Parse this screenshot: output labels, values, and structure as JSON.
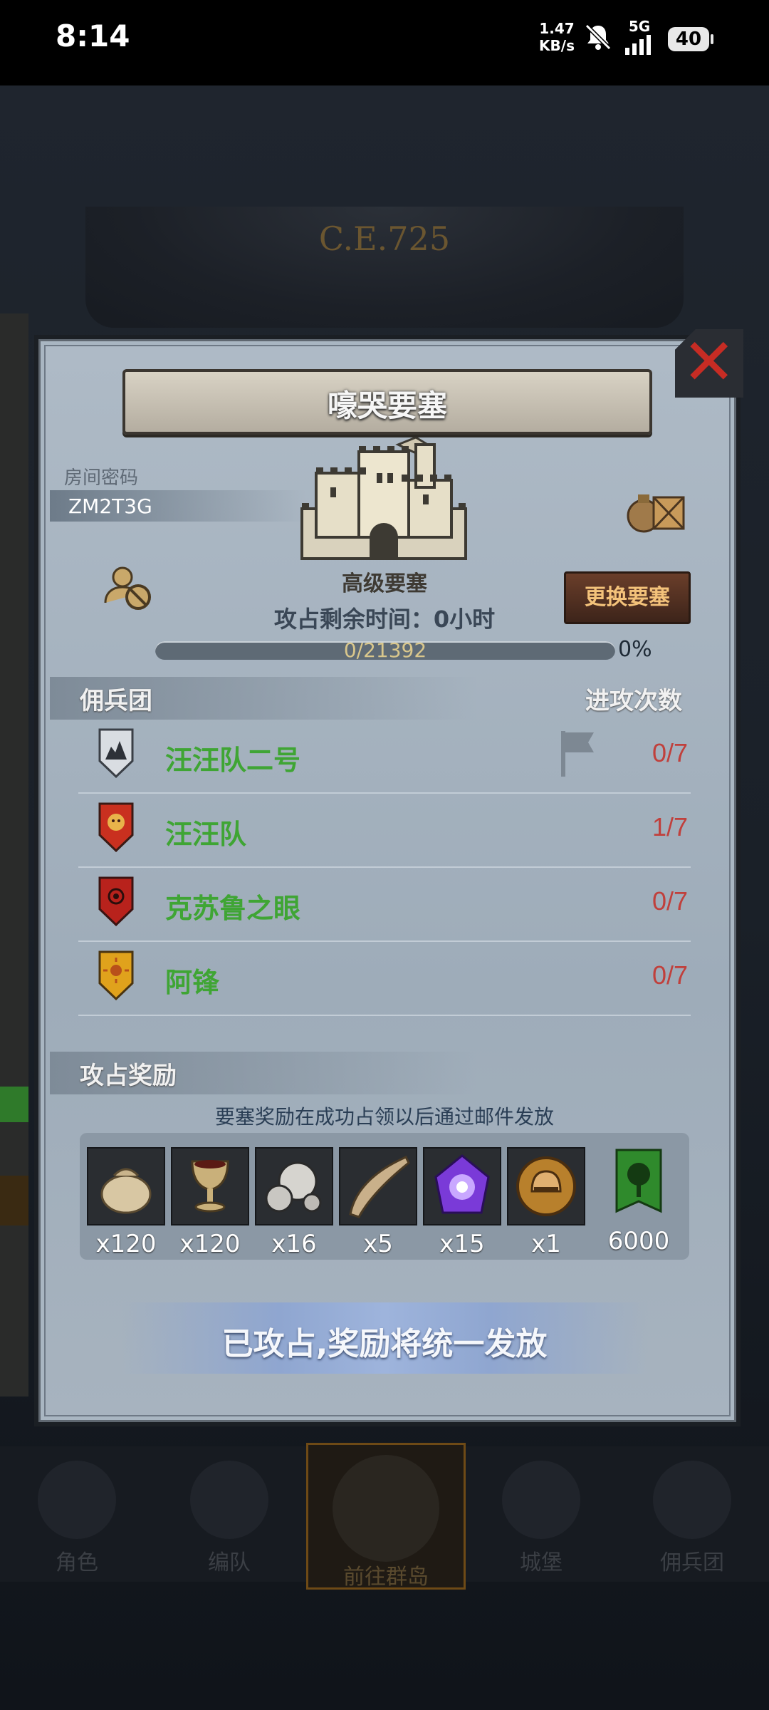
{
  "status_bar": {
    "time": "8:14",
    "net_speed_value": "1.47",
    "net_speed_unit": "KB/s",
    "network": "5G",
    "battery": "40",
    "icons": [
      "mute-icon",
      "signal-icon",
      "battery-icon"
    ]
  },
  "background": {
    "year_label": "C.E.725"
  },
  "dialog": {
    "title": "嚎哭要塞",
    "room_code_label": "房间密码",
    "room_code": "ZM2T3G",
    "fortress_name": "高级要塞",
    "change_button": "更换要塞",
    "time_remaining": "攻占剩余时间：0小时",
    "progress_text": "0/21392",
    "progress_percent": "0%",
    "progress_value": 0
  },
  "mercenaries": {
    "header_left": "佣兵团",
    "header_right": "进攻次数",
    "rows": [
      {
        "name": "汪汪队二号",
        "count": "0/7",
        "emblem": "mountain-shield",
        "color": "#d9dde2"
      },
      {
        "name": "汪汪队",
        "count": "1/7",
        "emblem": "lion-shield",
        "color": "#c9301f"
      },
      {
        "name": "克苏鲁之眼",
        "count": "0/7",
        "emblem": "eye-shield",
        "color": "#b8221c"
      },
      {
        "name": "阿锋",
        "count": "0/7",
        "emblem": "sun-shield",
        "color": "#e0a21c"
      }
    ]
  },
  "rewards": {
    "header": "攻占奖励",
    "note": "要塞奖励在成功占领以后通过邮件发放",
    "items": [
      {
        "icon": "sack-icon",
        "qty": "x120"
      },
      {
        "icon": "goblet-icon",
        "qty": "x120"
      },
      {
        "icon": "ore-icon",
        "qty": "x16"
      },
      {
        "icon": "horn-icon",
        "qty": "x5"
      },
      {
        "icon": "crystal-icon",
        "qty": "x15"
      },
      {
        "icon": "helmet-coin-icon",
        "qty": "x1"
      },
      {
        "icon": "tree-banner-icon",
        "qty": "6000"
      }
    ]
  },
  "status_banner": "已攻占,奖励将统一发放",
  "bottom_nav": {
    "items": [
      {
        "label": "角色"
      },
      {
        "label": "编队"
      },
      {
        "label": "前往群岛"
      },
      {
        "label": "城堡"
      },
      {
        "label": "佣兵团"
      }
    ]
  }
}
